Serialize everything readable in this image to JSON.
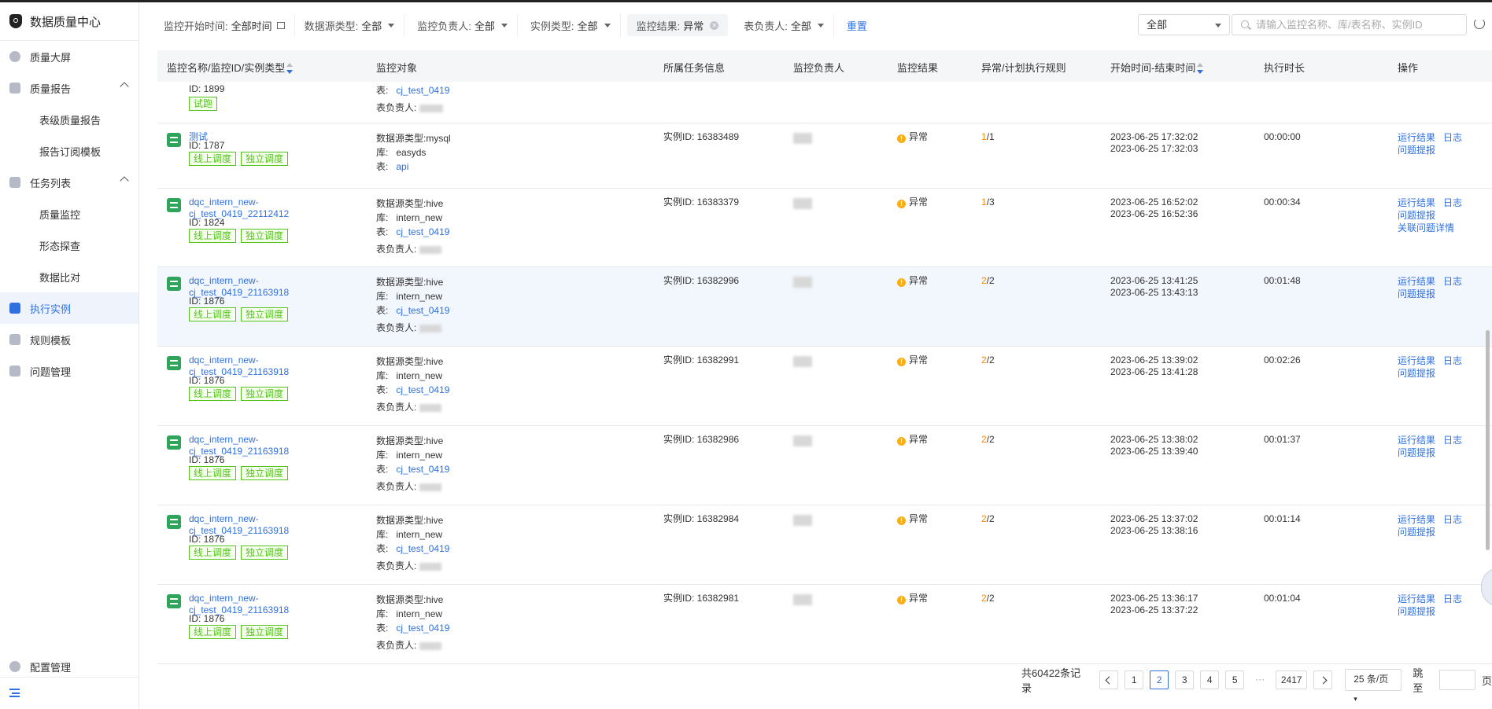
{
  "app": {
    "title": "数据质量中心"
  },
  "sidebar": {
    "items": [
      {
        "label": "质量大屏",
        "icon": "dashboard-icon"
      },
      {
        "label": "质量报告",
        "icon": "report-icon",
        "expandable": true
      },
      {
        "label": "表级质量报告",
        "sub": true
      },
      {
        "label": "报告订阅模板",
        "sub": true
      },
      {
        "label": "任务列表",
        "icon": "task-list-icon",
        "expandable": true
      },
      {
        "label": "质量监控",
        "sub": true
      },
      {
        "label": "形态探查",
        "sub": true
      },
      {
        "label": "数据比对",
        "sub": true
      },
      {
        "label": "执行实例",
        "icon": "instance-icon",
        "active": true
      },
      {
        "label": "规则模板",
        "icon": "template-icon"
      },
      {
        "label": "问题管理",
        "icon": "issue-icon"
      }
    ],
    "bottom": {
      "label": "配置管理",
      "icon": "gear-icon"
    }
  },
  "filters": {
    "start_time": {
      "label": "监控开始时间:",
      "value": "全部时间"
    },
    "datasource": {
      "label": "数据源类型:",
      "value": "全部"
    },
    "owner": {
      "label": "监控负责人:",
      "value": "全部"
    },
    "instance_type": {
      "label": "实例类型:",
      "value": "全部"
    },
    "result": {
      "label": "监控结果:",
      "value": "异常"
    },
    "table_owner": {
      "label": "表负责人:",
      "value": "全部"
    },
    "reset": "重置",
    "scope": "全部",
    "search_placeholder": "请输入监控名称、库/表名称、实例ID"
  },
  "table": {
    "headers": [
      "监控名称/监控ID/实例类型",
      "监控对象",
      "所属任务信息",
      "监控负责人",
      "监控结果",
      "异常/计划执行规则",
      "开始时间-结束时间",
      "执行时长",
      "操作"
    ],
    "partial_row": {
      "id": "ID: 1899",
      "tag": "试跑",
      "table_label": "表:",
      "table": "cj_test_0419",
      "owner_label": "表负责人:"
    },
    "rows": [
      {
        "name": "测试",
        "name2": "",
        "id": "ID: 1787",
        "tags": [
          "线上调度",
          "独立调度"
        ],
        "obj": {
          "ds_label": "数据源类型:",
          "ds": "mysql",
          "db_label": "库:",
          "db": "easyds",
          "tbl_label": "表:",
          "tbl": "api",
          "owner_label": ""
        },
        "instance": "实例ID: 16383489",
        "result": "异常",
        "abn": "1",
        "plan": "/1",
        "start": "2023-06-25 17:32:02",
        "end": "2023-06-25 17:32:03",
        "dur": "00:00:00",
        "ops": [
          "运行结果",
          "日志",
          "问题提报"
        ]
      },
      {
        "name": "dqc_intern_new-",
        "name2": "cj_test_0419_22112412",
        "id": "ID: 1824",
        "tags": [
          "线上调度",
          "独立调度"
        ],
        "obj": {
          "ds_label": "数据源类型:",
          "ds": "hive",
          "db_label": "库:",
          "db": "intern_new",
          "tbl_label": "表:",
          "tbl": "cj_test_0419",
          "owner_label": "表负责人:"
        },
        "instance": "实例ID: 16383379",
        "result": "异常",
        "abn": "1",
        "plan": "/3",
        "start": "2023-06-25 16:52:02",
        "end": "2023-06-25 16:52:36",
        "dur": "00:00:34",
        "ops": [
          "运行结果",
          "日志",
          "问题提报",
          "关联问题详情"
        ]
      },
      {
        "name": "dqc_intern_new-",
        "name2": "cj_test_0419_21163918",
        "id": "ID: 1876",
        "tags": [
          "线上调度",
          "独立调度"
        ],
        "obj": {
          "ds_label": "数据源类型:",
          "ds": "hive",
          "db_label": "库:",
          "db": "intern_new",
          "tbl_label": "表:",
          "tbl": "cj_test_0419",
          "owner_label": "表负责人:"
        },
        "instance": "实例ID: 16382996",
        "result": "异常",
        "abn": "2",
        "plan": "/2",
        "start": "2023-06-25 13:41:25",
        "end": "2023-06-25 13:43:13",
        "dur": "00:01:48",
        "ops": [
          "运行结果",
          "日志",
          "问题提报"
        ],
        "highlight": true
      },
      {
        "name": "dqc_intern_new-",
        "name2": "cj_test_0419_21163918",
        "id": "ID: 1876",
        "tags": [
          "线上调度",
          "独立调度"
        ],
        "obj": {
          "ds_label": "数据源类型:",
          "ds": "hive",
          "db_label": "库:",
          "db": "intern_new",
          "tbl_label": "表:",
          "tbl": "cj_test_0419",
          "owner_label": "表负责人:"
        },
        "instance": "实例ID: 16382991",
        "result": "异常",
        "abn": "2",
        "plan": "/2",
        "start": "2023-06-25 13:39:02",
        "end": "2023-06-25 13:41:28",
        "dur": "00:02:26",
        "ops": [
          "运行结果",
          "日志",
          "问题提报"
        ]
      },
      {
        "name": "dqc_intern_new-",
        "name2": "cj_test_0419_21163918",
        "id": "ID: 1876",
        "tags": [
          "线上调度",
          "独立调度"
        ],
        "obj": {
          "ds_label": "数据源类型:",
          "ds": "hive",
          "db_label": "库:",
          "db": "intern_new",
          "tbl_label": "表:",
          "tbl": "cj_test_0419",
          "owner_label": "表负责人:"
        },
        "instance": "实例ID: 16382986",
        "result": "异常",
        "abn": "2",
        "plan": "/2",
        "start": "2023-06-25 13:38:02",
        "end": "2023-06-25 13:39:40",
        "dur": "00:01:37",
        "ops": [
          "运行结果",
          "日志",
          "问题提报"
        ]
      },
      {
        "name": "dqc_intern_new-",
        "name2": "cj_test_0419_21163918",
        "id": "ID: 1876",
        "tags": [
          "线上调度",
          "独立调度"
        ],
        "obj": {
          "ds_label": "数据源类型:",
          "ds": "hive",
          "db_label": "库:",
          "db": "intern_new",
          "tbl_label": "表:",
          "tbl": "cj_test_0419",
          "owner_label": "表负责人:"
        },
        "instance": "实例ID: 16382984",
        "result": "异常",
        "abn": "2",
        "plan": "/2",
        "start": "2023-06-25 13:37:02",
        "end": "2023-06-25 13:38:16",
        "dur": "00:01:14",
        "ops": [
          "运行结果",
          "日志",
          "问题提报"
        ]
      },
      {
        "name": "dqc_intern_new-",
        "name2": "cj_test_0419_21163918",
        "id": "ID: 1876",
        "tags": [
          "线上调度",
          "独立调度"
        ],
        "obj": {
          "ds_label": "数据源类型:",
          "ds": "hive",
          "db_label": "库:",
          "db": "intern_new",
          "tbl_label": "表:",
          "tbl": "cj_test_0419",
          "owner_label": "表负责人:"
        },
        "instance": "实例ID: 16382981",
        "result": "异常",
        "abn": "2",
        "plan": "/2",
        "start": "2023-06-25 13:36:17",
        "end": "2023-06-25 13:37:22",
        "dur": "00:01:04",
        "ops": [
          "运行结果",
          "日志",
          "问题提报"
        ]
      }
    ]
  },
  "pagination": {
    "total": "共60422条记录",
    "pages": [
      "1",
      "2",
      "3",
      "4",
      "5"
    ],
    "current": "2",
    "ellipsis": "···",
    "last": "2417",
    "page_size": "25 条/页",
    "jump_label": "跳至",
    "page_suffix": "页"
  },
  "colors": {
    "accent": "#2f6fe0",
    "success": "#52c41a",
    "warning": "#faad14",
    "icon_green": "#2ea55b"
  }
}
